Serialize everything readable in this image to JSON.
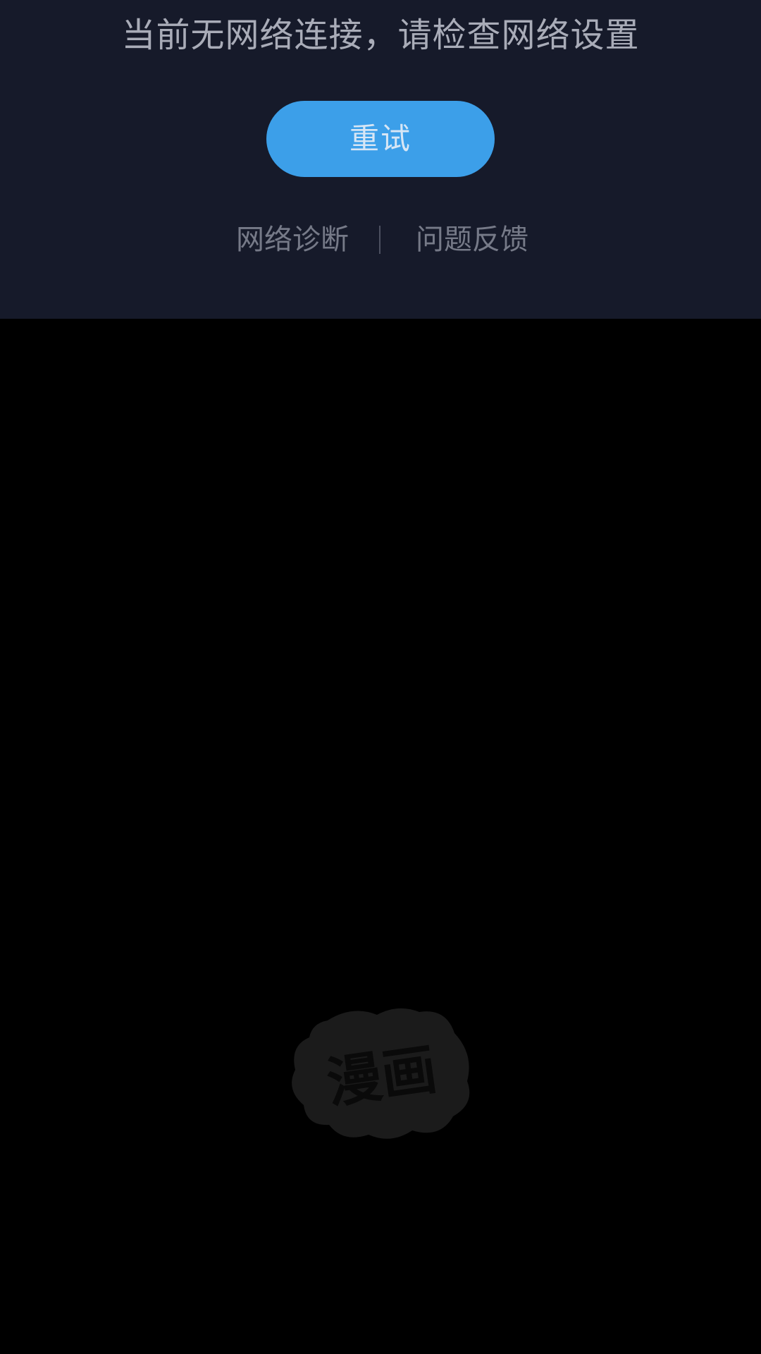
{
  "error": {
    "message": "当前无网络连接，请检查网络设置",
    "retry_label": "重试",
    "links": {
      "diagnose_label": "网络诊断",
      "feedback_label": "问题反馈"
    }
  },
  "placeholder": {
    "logo_text": "漫画",
    "logo_icon": "comic-burst-logo"
  },
  "colors": {
    "panel_bg": "#161a2a",
    "content_bg": "#000000",
    "accent": "#3c9fe9",
    "message_text": "#a9acb8",
    "link_text": "#767a88"
  }
}
